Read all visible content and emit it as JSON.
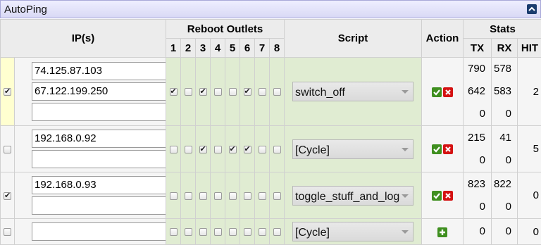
{
  "app": {
    "title": "AutoPing"
  },
  "header": {
    "ips": "IP(s)",
    "reboot_outlets": "Reboot Outlets",
    "outlets": [
      "1",
      "2",
      "3",
      "4",
      "5",
      "6",
      "7",
      "8"
    ],
    "script": "Script",
    "action": "Action",
    "stats": "Stats",
    "tx": "TX",
    "rx": "RX",
    "hit": "HIT"
  },
  "rows": [
    {
      "selected": true,
      "ips": [
        "74.125.87.103",
        "67.122.199.250",
        ""
      ],
      "outlets": [
        true,
        false,
        true,
        false,
        false,
        true,
        false,
        false
      ],
      "script": "switch_off",
      "tx": [
        "790",
        "642",
        "0"
      ],
      "rx": [
        "578",
        "583",
        "0"
      ],
      "hit": "2"
    },
    {
      "selected": false,
      "ips": [
        "192.168.0.92",
        ""
      ],
      "outlets": [
        false,
        false,
        true,
        false,
        true,
        true,
        false,
        false
      ],
      "script": "[Cycle]",
      "tx": [
        "215",
        "0"
      ],
      "rx": [
        "41",
        "0"
      ],
      "hit": "5"
    },
    {
      "selected": true,
      "ips": [
        "192.168.0.93",
        ""
      ],
      "outlets": [
        false,
        false,
        false,
        false,
        false,
        false,
        false,
        false
      ],
      "script": "toggle_stuff_and_log",
      "tx": [
        "823",
        "0"
      ],
      "rx": [
        "822",
        "0"
      ],
      "hit": "0"
    },
    {
      "selected": false,
      "ips": [
        ""
      ],
      "outlets": [
        false,
        false,
        false,
        false,
        false,
        false,
        false,
        false
      ],
      "script": "[Cycle]",
      "tx": [
        "0"
      ],
      "rx": [
        "0"
      ],
      "hit": "0"
    }
  ],
  "colors": {
    "accent_green": "#3f8f1f",
    "delete_red": "#d41212",
    "outlet_bg": "#e0ecd2"
  },
  "icons": {
    "collapse": "chevron-up-icon",
    "confirm": "check-icon",
    "delete": "x-icon",
    "add": "plus-icon"
  }
}
